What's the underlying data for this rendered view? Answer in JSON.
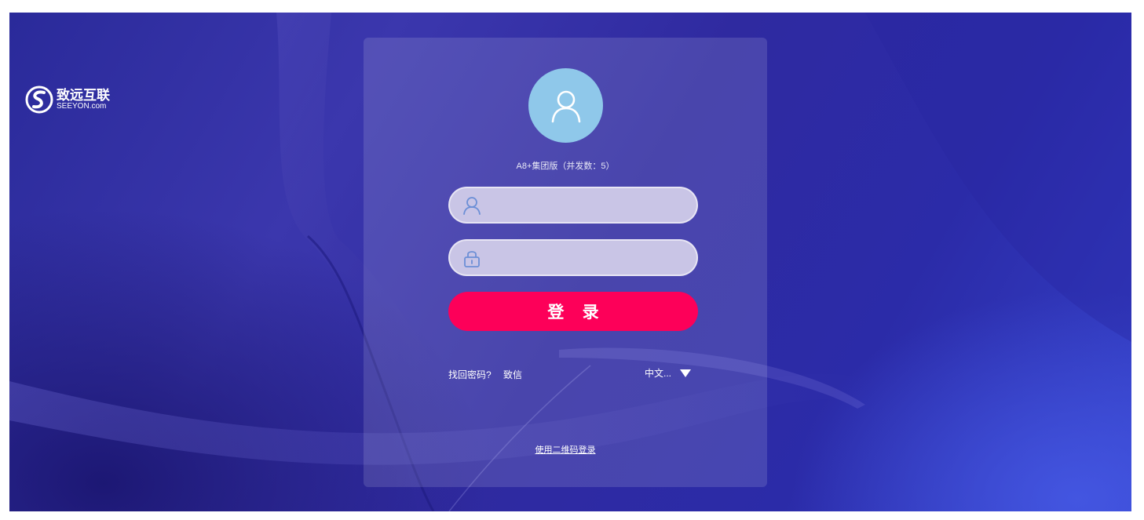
{
  "brand": {
    "name_cn": "致远互联",
    "name_en": "SEEYON.com"
  },
  "login": {
    "edition": "A8+集团版（并发数：5）",
    "username_placeholder": "",
    "password_placeholder": "",
    "submit_label": "登 录",
    "forgot_password": "找回密码?",
    "zhixin": "致信",
    "language": "中文...",
    "qr_login": "使用二维码登录"
  },
  "colors": {
    "avatar_bg": "#8fc8ea",
    "button_bg": "#fd0059",
    "field_bg": "#c9c5e6",
    "background": "#2f2aa0"
  },
  "icons": {
    "avatar": "user-icon",
    "username": "user-icon",
    "password": "lock-icon",
    "language": "caret-down-icon",
    "logo": "seeyon-logo-icon"
  }
}
